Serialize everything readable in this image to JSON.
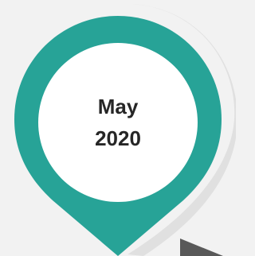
{
  "marker": {
    "month": "May",
    "year": "2020"
  },
  "colors": {
    "background": "#f2f2f2",
    "pin": "#27a397",
    "pin_inner": "#ffffff",
    "text": "#262626",
    "shadow": "#e0e0e0",
    "arrow": "#595959"
  },
  "icons": {
    "marker": "map-pin-icon",
    "arrow": "triangle-arrow-icon"
  }
}
